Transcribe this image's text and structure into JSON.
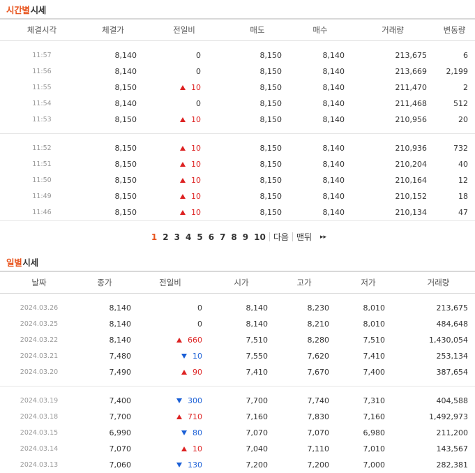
{
  "time_section": {
    "title_highlight": "시간별",
    "title_rest": "시세",
    "headers": [
      "체결시각",
      "체결가",
      "전일비",
      "매도",
      "매수",
      "거래량",
      "변동량"
    ],
    "group1": [
      {
        "time": "11:57",
        "price": "8,140",
        "diff": "0",
        "dir": "none",
        "ask": "8,150",
        "bid": "8,140",
        "volume": "213,675",
        "change": "6"
      },
      {
        "time": "11:56",
        "price": "8,140",
        "diff": "0",
        "dir": "none",
        "ask": "8,150",
        "bid": "8,140",
        "volume": "213,669",
        "change": "2,199"
      },
      {
        "time": "11:55",
        "price": "8,150",
        "diff": "10",
        "dir": "up",
        "ask": "8,150",
        "bid": "8,140",
        "volume": "211,470",
        "change": "2"
      },
      {
        "time": "11:54",
        "price": "8,140",
        "diff": "0",
        "dir": "none",
        "ask": "8,150",
        "bid": "8,140",
        "volume": "211,468",
        "change": "512"
      },
      {
        "time": "11:53",
        "price": "8,150",
        "diff": "10",
        "dir": "up",
        "ask": "8,150",
        "bid": "8,140",
        "volume": "210,956",
        "change": "20"
      }
    ],
    "group2": [
      {
        "time": "11:52",
        "price": "8,150",
        "diff": "10",
        "dir": "up",
        "ask": "8,150",
        "bid": "8,140",
        "volume": "210,936",
        "change": "732"
      },
      {
        "time": "11:51",
        "price": "8,150",
        "diff": "10",
        "dir": "up",
        "ask": "8,150",
        "bid": "8,140",
        "volume": "210,204",
        "change": "40"
      },
      {
        "time": "11:50",
        "price": "8,150",
        "diff": "10",
        "dir": "up",
        "ask": "8,150",
        "bid": "8,140",
        "volume": "210,164",
        "change": "12"
      },
      {
        "time": "11:49",
        "price": "8,150",
        "diff": "10",
        "dir": "up",
        "ask": "8,150",
        "bid": "8,140",
        "volume": "210,152",
        "change": "18"
      },
      {
        "time": "11:46",
        "price": "8,150",
        "diff": "10",
        "dir": "up",
        "ask": "8,150",
        "bid": "8,140",
        "volume": "210,134",
        "change": "47"
      }
    ]
  },
  "pager": {
    "pages": [
      "1",
      "2",
      "3",
      "4",
      "5",
      "6",
      "7",
      "8",
      "9",
      "10"
    ],
    "current": "1",
    "next_label": "다음",
    "last_label": "맨뒤",
    "last_icon": "double-chevron-right-icon"
  },
  "daily_section": {
    "title_highlight": "일별",
    "title_rest": "시세",
    "headers": [
      "날짜",
      "종가",
      "전일비",
      "시가",
      "고가",
      "저가",
      "거래량"
    ],
    "group1": [
      {
        "date": "2024.03.26",
        "close": "8,140",
        "diff": "0",
        "dir": "none",
        "open": "8,140",
        "high": "8,230",
        "low": "8,010",
        "volume": "213,675"
      },
      {
        "date": "2024.03.25",
        "close": "8,140",
        "diff": "0",
        "dir": "none",
        "open": "8,140",
        "high": "8,210",
        "low": "8,010",
        "volume": "484,648"
      },
      {
        "date": "2024.03.22",
        "close": "8,140",
        "diff": "660",
        "dir": "up",
        "open": "7,510",
        "high": "8,280",
        "low": "7,510",
        "volume": "1,430,054"
      },
      {
        "date": "2024.03.21",
        "close": "7,480",
        "diff": "10",
        "dir": "down",
        "open": "7,550",
        "high": "7,620",
        "low": "7,410",
        "volume": "253,134"
      },
      {
        "date": "2024.03.20",
        "close": "7,490",
        "diff": "90",
        "dir": "up",
        "open": "7,410",
        "high": "7,670",
        "low": "7,400",
        "volume": "387,654"
      }
    ],
    "group2": [
      {
        "date": "2024.03.19",
        "close": "7,400",
        "diff": "300",
        "dir": "down",
        "open": "7,700",
        "high": "7,740",
        "low": "7,310",
        "volume": "404,588"
      },
      {
        "date": "2024.03.18",
        "close": "7,700",
        "diff": "710",
        "dir": "up",
        "open": "7,160",
        "high": "7,830",
        "low": "7,160",
        "volume": "1,492,973"
      },
      {
        "date": "2024.03.15",
        "close": "6,990",
        "diff": "80",
        "dir": "down",
        "open": "7,070",
        "high": "7,070",
        "low": "6,980",
        "volume": "211,200"
      },
      {
        "date": "2024.03.14",
        "close": "7,070",
        "diff": "10",
        "dir": "up",
        "open": "7,040",
        "high": "7,110",
        "low": "7,010",
        "volume": "143,567"
      },
      {
        "date": "2024.03.13",
        "close": "7,060",
        "diff": "130",
        "dir": "down",
        "open": "7,200",
        "high": "7,200",
        "low": "7,000",
        "volume": "282,381"
      }
    ]
  },
  "colors": {
    "accent": "#e8541d",
    "up": "#dd2222",
    "down": "#1a5fd6"
  }
}
